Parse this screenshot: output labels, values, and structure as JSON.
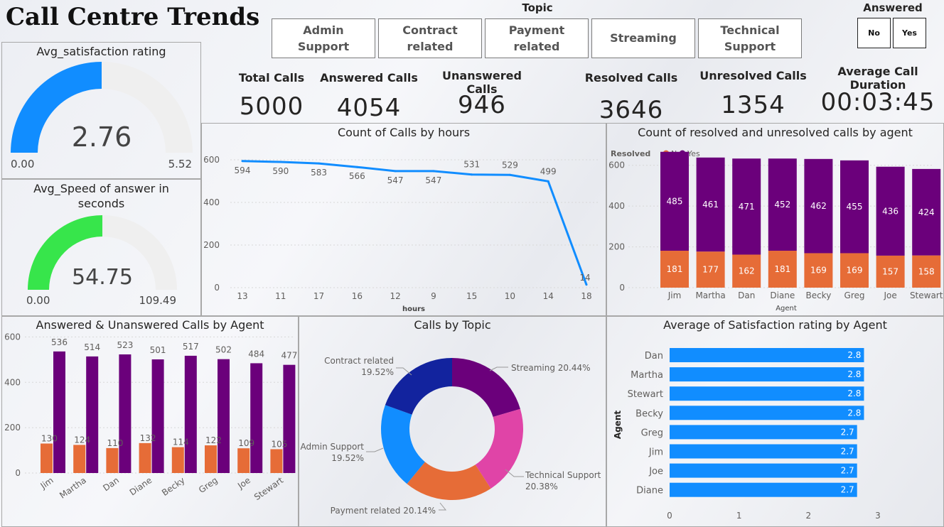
{
  "title": "Call Centre Trends",
  "topic_slicer": {
    "heading": "Topic",
    "items": [
      "Admin Support",
      "Contract related",
      "Payment related",
      "Streaming",
      "Technical Support"
    ]
  },
  "answered_slicer": {
    "heading": "Answered",
    "items": [
      "No",
      "Yes"
    ]
  },
  "kpis": [
    {
      "label": "Total Calls",
      "value": "5000"
    },
    {
      "label": "Answered Calls",
      "value": "4054"
    },
    {
      "label": "Unanswered Calls",
      "value": "946"
    },
    {
      "label": "Resolved Calls",
      "value": "3646"
    },
    {
      "label": "Unresolved Calls",
      "value": "1354"
    },
    {
      "label": "Average Call Duration",
      "value": "00:03:45"
    }
  ],
  "colors": {
    "blue": "#118dff",
    "green": "#37e54b",
    "gauge_bg": "#efefef",
    "purple": "#6b007b",
    "orange": "#e66c37",
    "navy": "#12239e",
    "pink": "#e044a7"
  },
  "chart_data": [
    {
      "type": "gauge",
      "title": "Avg_satisfaction rating",
      "value": 2.76,
      "min": 0,
      "max": 5.52,
      "value_label": "2.76",
      "min_label": "0.00",
      "max_label": "5.52"
    },
    {
      "type": "gauge",
      "title": "Avg_Speed of answer in seconds",
      "value": 54.75,
      "min": 0,
      "max": 109.49,
      "value_label": "54.75",
      "min_label": "0.00",
      "max_label": "109.49"
    },
    {
      "type": "line",
      "title": "Count of Calls by hours",
      "xlabel": "hours",
      "categories": [
        "13",
        "11",
        "17",
        "16",
        "12",
        "9",
        "15",
        "10",
        "14",
        "18"
      ],
      "values": [
        594,
        590,
        583,
        566,
        547,
        547,
        531,
        529,
        499,
        14
      ],
      "ylim": [
        0,
        650
      ],
      "yticks": [
        0,
        200,
        400,
        600
      ]
    },
    {
      "type": "bar",
      "stacked": true,
      "title": "Count of resolved and unresolved calls by agent",
      "legend_title": "Resolved",
      "xlabel": "Agent",
      "categories": [
        "Jim",
        "Martha",
        "Dan",
        "Diane",
        "Becky",
        "Greg",
        "Joe",
        "Stewart"
      ],
      "series": [
        {
          "name": "No",
          "values": [
            181,
            177,
            162,
            181,
            169,
            169,
            157,
            158
          ]
        },
        {
          "name": "Yes",
          "values": [
            485,
            461,
            471,
            452,
            462,
            455,
            436,
            424
          ]
        }
      ],
      "ylim": [
        0,
        700
      ],
      "yticks": [
        0,
        200,
        400,
        600
      ]
    },
    {
      "type": "bar",
      "title": "Answered & Unanswered Calls by Agent",
      "categories": [
        "Jim",
        "Martha",
        "Dan",
        "Diane",
        "Becky",
        "Greg",
        "Joe",
        "Stewart"
      ],
      "series": [
        {
          "values": [
            130,
            124,
            110,
            132,
            114,
            122,
            109,
            105
          ]
        },
        {
          "values": [
            536,
            514,
            523,
            501,
            517,
            502,
            484,
            477
          ]
        }
      ],
      "ylim": [
        0,
        620
      ],
      "yticks": [
        0,
        200,
        400,
        600
      ]
    },
    {
      "type": "pie",
      "donut": true,
      "title": "Calls by Topic",
      "slices": [
        {
          "label": "Streaming",
          "value": 20.44,
          "display": "Streaming 20.44%"
        },
        {
          "label": "Technical Support",
          "value": 20.38,
          "display": "Technical Support 20.38%"
        },
        {
          "label": "Payment related",
          "value": 20.14,
          "display": "Payment related 20.14%"
        },
        {
          "label": "Admin Support",
          "value": 19.52,
          "display": "Admin Support 19.52%"
        },
        {
          "label": "Contract related",
          "value": 19.52,
          "display": "Contract related 19.52%"
        }
      ]
    },
    {
      "type": "bar",
      "orientation": "horizontal",
      "title": "Average of Satisfaction rating by Agent",
      "ylabel": "Agent",
      "categories": [
        "Dan",
        "Martha",
        "Stewart",
        "Becky",
        "Greg",
        "Jim",
        "Joe",
        "Diane"
      ],
      "values": [
        2.8,
        2.8,
        2.8,
        2.8,
        2.7,
        2.7,
        2.7,
        2.7
      ],
      "value_labels": [
        "2.8",
        "2.8",
        "2.8",
        "2.8",
        "2.7",
        "2.7",
        "2.7",
        "2.7"
      ],
      "xlim": [
        0,
        3
      ],
      "xticks": [
        0,
        1,
        2,
        3
      ]
    }
  ]
}
